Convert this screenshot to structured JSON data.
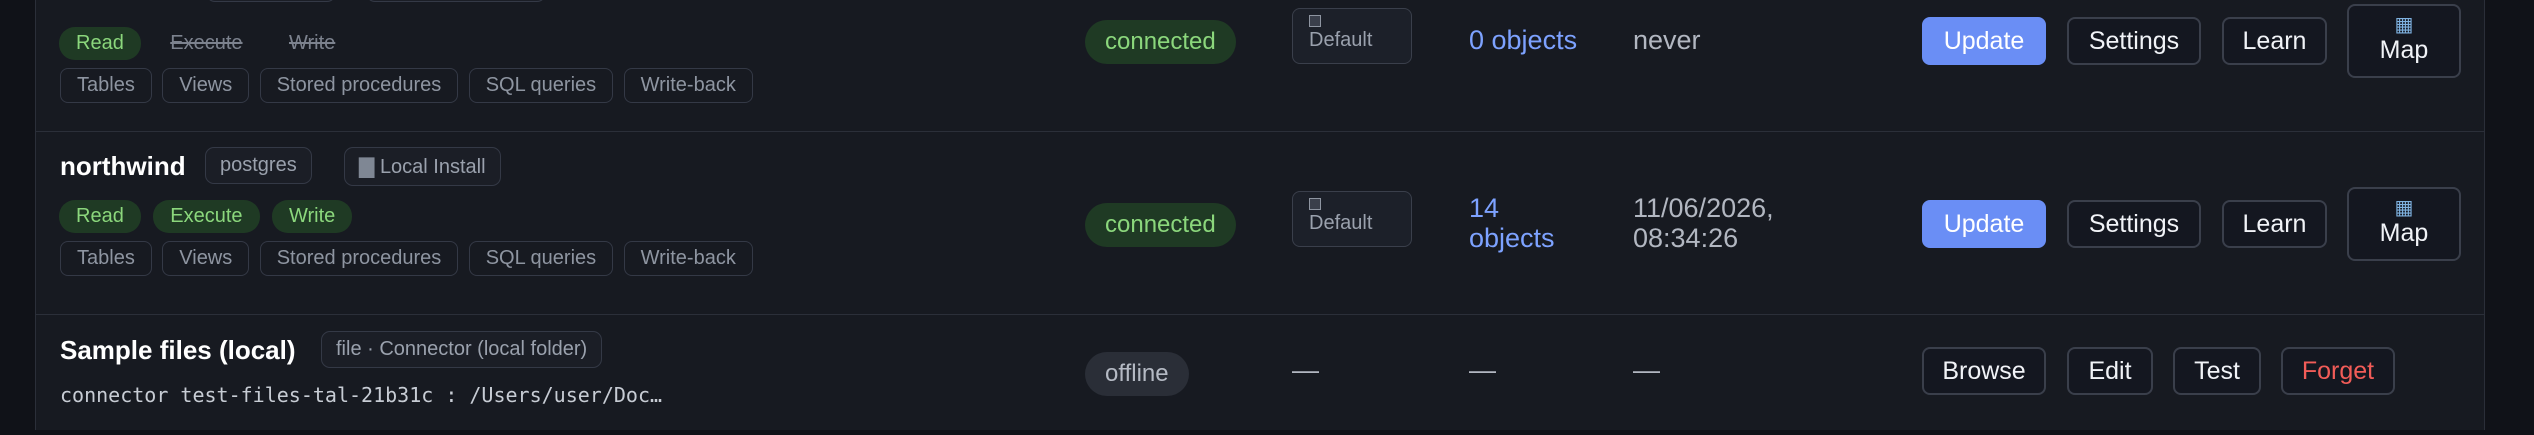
{
  "rows": [
    {
      "name": "",
      "permissions": [
        {
          "label": "Read",
          "enabled": true
        },
        {
          "label": "Execute",
          "enabled": false
        },
        {
          "label": "Write",
          "enabled": false
        }
      ],
      "features": [
        "Tables",
        "Views",
        "Stored procedures",
        "SQL queries",
        "Write-back"
      ],
      "status": "connected",
      "default_label": "Default",
      "objects": "0 objects",
      "last_sync": "never",
      "actions": {
        "update": "Update",
        "settings": "Settings",
        "learn": "Learn",
        "map": "Map"
      }
    },
    {
      "name": "northwind",
      "engine_tag": "postgres",
      "install_tag": "Local Install",
      "permissions": [
        {
          "label": "Read",
          "enabled": true
        },
        {
          "label": "Execute",
          "enabled": true
        },
        {
          "label": "Write",
          "enabled": true
        }
      ],
      "features": [
        "Tables",
        "Views",
        "Stored procedures",
        "SQL queries",
        "Write-back"
      ],
      "status": "connected",
      "default_label": "Default",
      "objects_line1": "14",
      "objects_line2": "objects",
      "last_sync_line1": "11/06/2026,",
      "last_sync_line2": "08:34:26",
      "actions": {
        "update": "Update",
        "settings": "Settings",
        "learn": "Learn",
        "map": "Map"
      }
    },
    {
      "name": "Sample files (local)",
      "type_tag": "file · Connector (local folder)",
      "path": "connector test-files-tal-21b31c : /Users/user/Doc…",
      "status": "offline",
      "default_label": "—",
      "objects": "—",
      "last_sync": "—",
      "actions": {
        "browse": "Browse",
        "edit": "Edit",
        "test": "Test",
        "forget": "Forget"
      }
    }
  ],
  "colors": {
    "primary": "#6a8ef5",
    "connected_text": "#8bd77c",
    "danger": "#f25c58",
    "link": "#7da2ff"
  },
  "icons": {
    "map": "map-icon",
    "install": "building-icon",
    "default": "square-icon"
  }
}
